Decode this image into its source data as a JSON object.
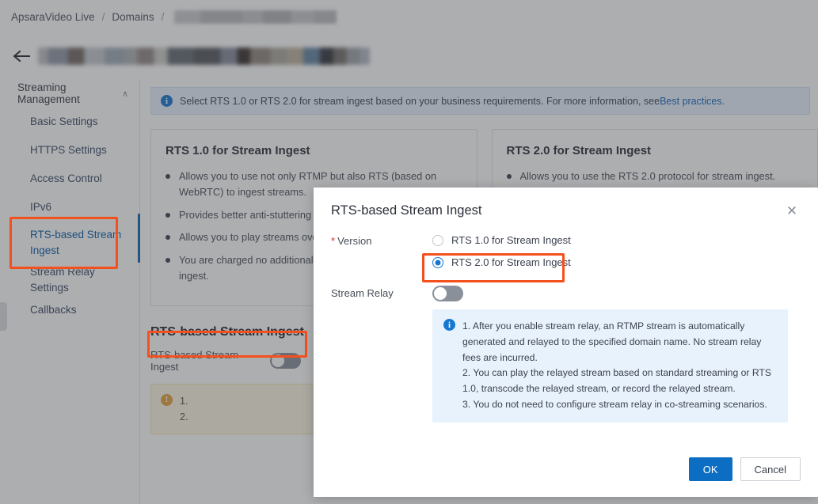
{
  "breadcrumb": {
    "items": [
      {
        "label": "ApsaraVideo Live",
        "type": "link"
      },
      {
        "label": "Domains",
        "type": "link"
      },
      {
        "label": "",
        "type": "redacted"
      }
    ],
    "separator": "/"
  },
  "back": {
    "icon": "back-arrow-icon"
  },
  "sidebar": {
    "group": {
      "label": "Streaming Management",
      "chevron": "∧"
    },
    "items": [
      {
        "label": "Basic Settings",
        "active": false
      },
      {
        "label": "HTTPS Settings",
        "active": false
      },
      {
        "label": "Access Control",
        "active": false
      },
      {
        "label": "IPv6",
        "active": false
      },
      {
        "label": "RTS-based Stream Ingest",
        "active": true
      },
      {
        "label": "Stream Relay Settings",
        "active": false
      },
      {
        "label": "Callbacks",
        "active": false
      }
    ]
  },
  "notice": {
    "icon": "info-icon",
    "text": "Select RTS 1.0 or RTS 2.0 for stream ingest based on your business requirements. For more information, see ",
    "link": "Best practices.",
    "accent": "#1677d2"
  },
  "cards": [
    {
      "title": "RTS 1.0 for Stream Ingest",
      "bullets": [
        "Allows you to use not only RTMP but also RTS (based on WebRTC) to ingest streams.",
        "Provides better anti-stuttering capabilities.",
        "Allows you to play streams over the RTS protocol.",
        "You are charged no additional fees for RTS-based stream ingest."
      ]
    },
    {
      "title": "RTS 2.0 for Stream Ingest",
      "bullets": [
        "Allows you to use the RTS 2.0 protocol for stream ingest."
      ]
    }
  ],
  "section": {
    "heading": "RTS-based Stream Ingest",
    "toggle_label": "RTS-based Stream Ingest",
    "toggle_state": "off",
    "warning": {
      "icon": "warning-icon",
      "lines": [
        "1.",
        "2."
      ]
    }
  },
  "modal": {
    "title": "RTS-based Stream Ingest",
    "close_icon": "close-icon",
    "version": {
      "label": "Version",
      "required_mark": "*",
      "options": [
        {
          "label": "RTS 1.0 for Stream Ingest",
          "selected": false
        },
        {
          "label": "RTS 2.0 for Stream Ingest",
          "selected": true
        }
      ]
    },
    "stream_relay": {
      "label": "Stream Relay",
      "state": "off"
    },
    "info": {
      "icon": "info-icon",
      "lines": [
        "1. After you enable stream relay, an RTMP stream is automatically generated and relayed to the specified domain name. No stream relay fees are incurred.",
        "2. You can play the relayed stream based on standard streaming or RTS 1.0, transcode the relayed stream, or record the relayed stream.",
        "3. You do not need to configure stream relay in co-streaming scenarios."
      ]
    },
    "buttons": {
      "ok": "OK",
      "cancel": "Cancel"
    }
  },
  "annotations": {
    "color": "#f4501e"
  }
}
